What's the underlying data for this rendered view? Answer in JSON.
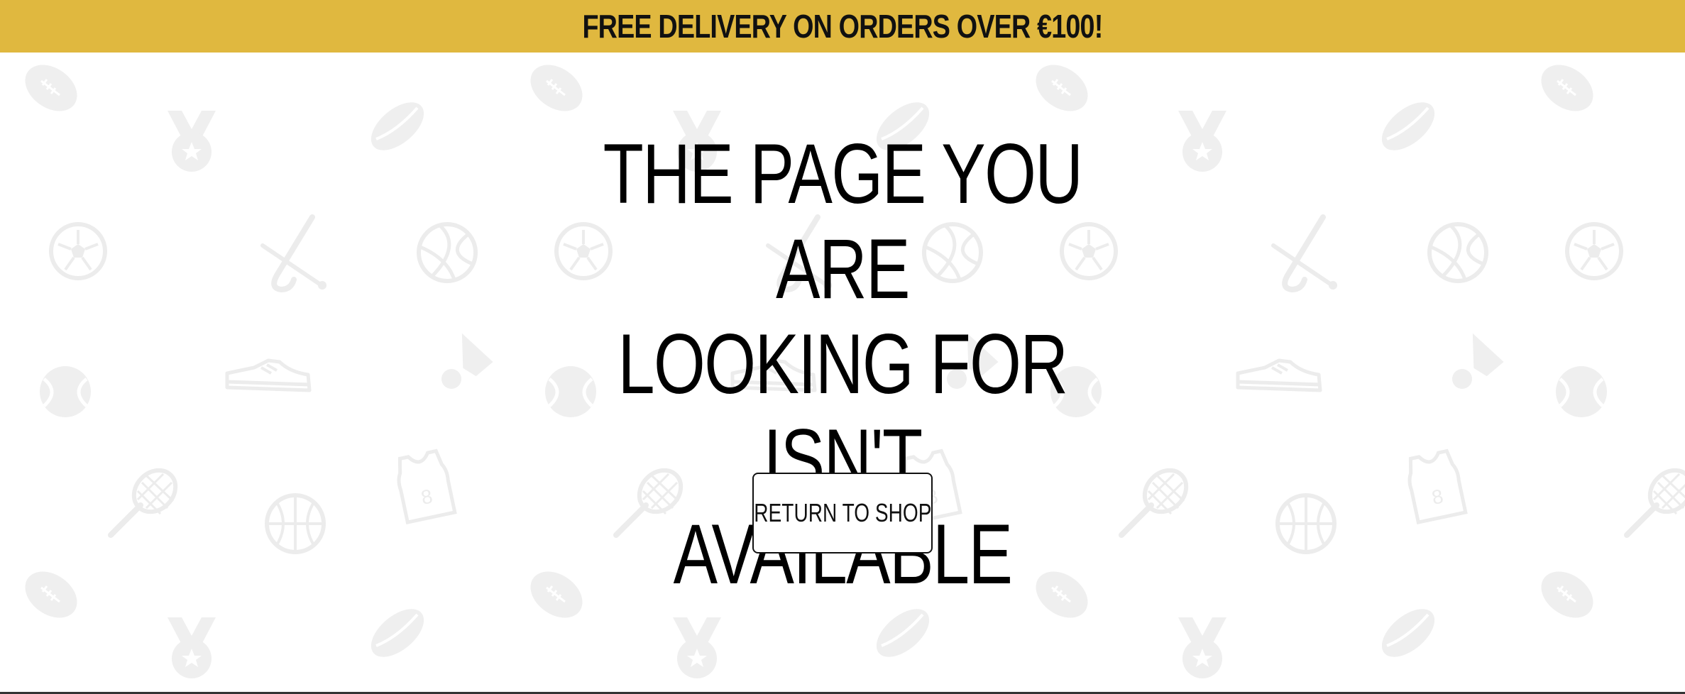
{
  "announcement": {
    "text": "FREE DELIVERY ON ORDERS OVER €100!",
    "background": "#e0b83f"
  },
  "error": {
    "heading_lines": [
      "THE PAGE YOU ARE",
      "LOOKING FOR ISN'T",
      "AVAILABLE"
    ],
    "button_label": "RETURN TO SHOP"
  },
  "pattern": {
    "icon_color": "#f2f2f2",
    "icons": [
      "football-icon",
      "medal-icon",
      "hockey-puck-icon",
      "soccer-ball-icon",
      "hockey-stick-icon",
      "volleyball-icon",
      "sneaker-icon",
      "shuttlecock-icon",
      "tennis-ball-icon",
      "badminton-racket-icon",
      "basketball-icon",
      "jersey-icon"
    ]
  }
}
